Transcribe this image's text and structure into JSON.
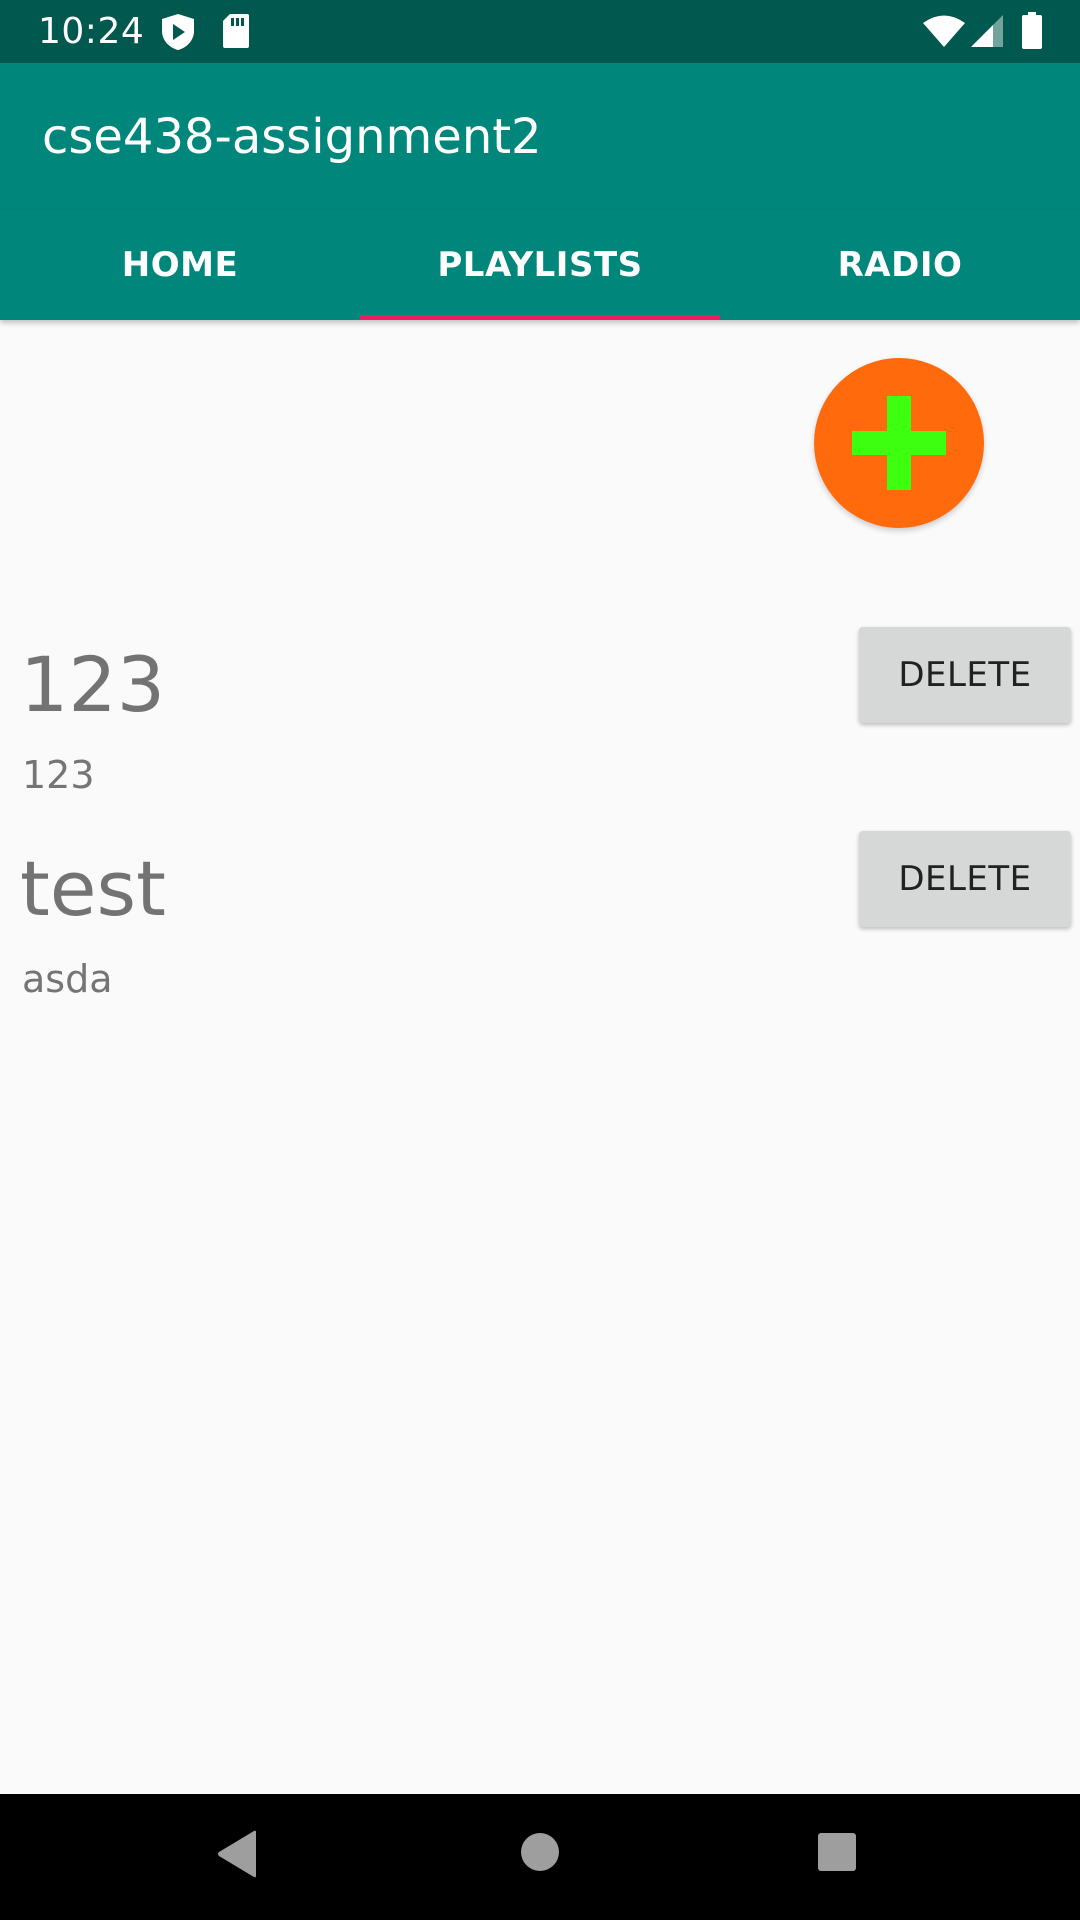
{
  "status_bar": {
    "time": "10:24",
    "icons": [
      "shield-icon",
      "sd-card-icon",
      "wifi-icon",
      "signal-icon",
      "battery-icon"
    ]
  },
  "app_bar": {
    "title": "cse438-assignment2",
    "color": "#00867a"
  },
  "tabs": [
    {
      "label": "HOME",
      "selected": false
    },
    {
      "label": "PLAYLISTS",
      "selected": true
    },
    {
      "label": "RADIO",
      "selected": false
    }
  ],
  "tab_indicator_color": "#e91e63",
  "add_button": {
    "icon": "plus-icon",
    "background": "#ff6a0c",
    "icon_color": "#3dff10"
  },
  "playlists": [
    {
      "name": "123",
      "description": "123",
      "delete_label": "DELETE"
    },
    {
      "name": "test",
      "description": "asda",
      "delete_label": "DELETE"
    }
  ],
  "nav_bar": {
    "icons": [
      "back-icon",
      "home-icon",
      "recents-icon"
    ]
  }
}
